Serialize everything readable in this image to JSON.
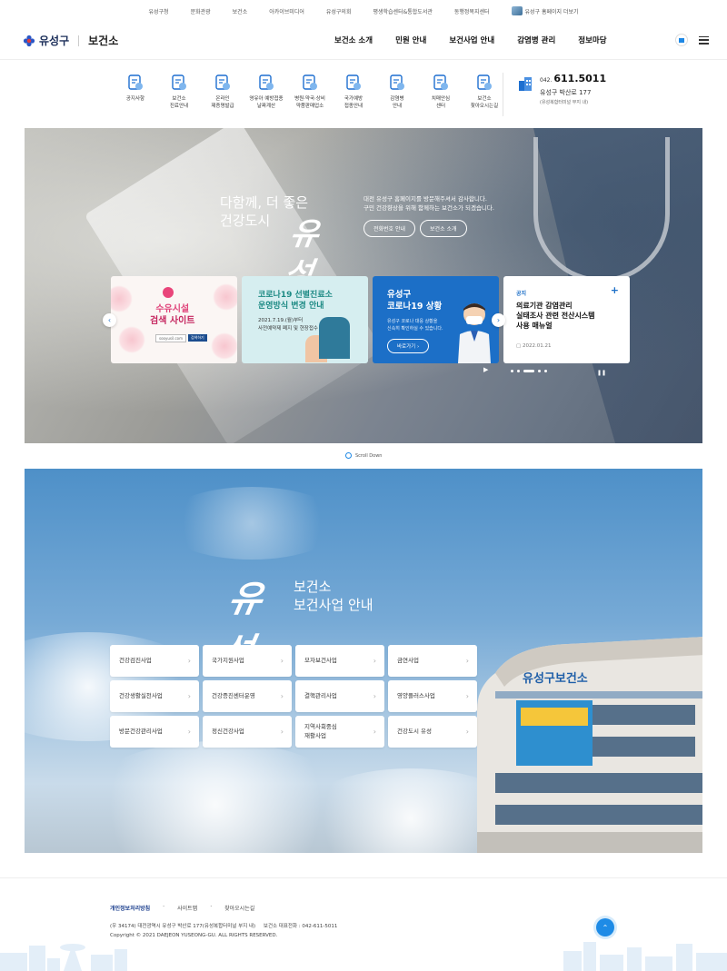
{
  "util": {
    "links": [
      "유성구청",
      "문화관광",
      "보건소",
      "아카이브미디어",
      "유성구의회",
      "평생학습센터&통합도서관",
      "동행정복지센터"
    ],
    "more": "유성구 홈페이지 더보기"
  },
  "header": {
    "logo": "유성구",
    "logo_sub": "보건소",
    "gnb": [
      "보건소 소개",
      "민원 안내",
      "보건사업 안내",
      "감염병 관리",
      "정보마당"
    ]
  },
  "quick": {
    "items": [
      {
        "l1": "공지사항",
        "l2": "",
        "icon": "megaphone-icon"
      },
      {
        "l1": "보건소",
        "l2": "진료안내",
        "icon": "clipboard-icon"
      },
      {
        "l1": "온라인",
        "l2": "제증명발급",
        "icon": "certificate-icon"
      },
      {
        "l1": "영유아 예방접종",
        "l2": "날짜계산",
        "icon": "calendar-icon"
      },
      {
        "l1": "병원·약국·상비",
        "l2": "약품판매업소",
        "icon": "pill-icon"
      },
      {
        "l1": "국가예방",
        "l2": "접종안내",
        "icon": "syringe-icon"
      },
      {
        "l1": "감염병",
        "l2": "안내",
        "icon": "mask-person-icon"
      },
      {
        "l1": "치매안심",
        "l2": "센터",
        "icon": "brain-doc-icon"
      },
      {
        "l1": "보건소",
        "l2": "찾아오시는길",
        "icon": "map-pin-icon"
      }
    ],
    "tel_prefix": "042.",
    "tel": "611.5011",
    "addr": "유성구 박산로 177",
    "addr2": "(유성복합터미널 부지 내)"
  },
  "hero": {
    "title_1": "다함께, 더 좋은",
    "title_2": "건강도시",
    "title_calli": "유성",
    "msg_1": "대전 유성구 홈페이지를 방문해주셔서 감사합니다.",
    "msg_2": "구민 건강향상을 위해 함께하는 보건소가 되겠습니다.",
    "btn_phone": "전화번호 안내",
    "btn_intro": "보건소 소개",
    "card1": {
      "title_1": "수유시설",
      "title_2": "검색 사이트",
      "tag": "sooyusil.com",
      "tag2": "검색하기"
    },
    "card2": {
      "title_1": "코로나19 선별진료소",
      "title_2": "운영방식 변경 안내",
      "s1": "2021.7.19.(월)부터",
      "s2": "사전예약제 폐지 및 현장접수"
    },
    "card3": {
      "title_1": "유성구",
      "title_2": "코로나19 상황",
      "s1": "유성구 코로나 대응 상황을",
      "s2": "신속히 확인하실 수 있습니다.",
      "btn": "바로가기"
    },
    "card4": {
      "label": "공지",
      "title_1": "의료기관 감염관리",
      "title_2": "실태조사 관련 전산시스템",
      "title_3": "사용 매뉴얼",
      "date": "2022.01.21"
    }
  },
  "scroll": "Scroll Down",
  "biz": {
    "calli": "유성",
    "title_1": "보건소",
    "title_2": "보건사업 안내",
    "items": [
      "건강검진사업",
      "국가지원사업",
      "모자보건사업",
      "금연사업",
      "건강생활실천사업",
      "건강증진센터운영",
      "결핵관리사업",
      "영양플러스사업",
      "방문건강관리사업",
      "정신건강사업",
      "지역사회중심\n재활사업",
      "건강도시 유성"
    ]
  },
  "footer": {
    "links": [
      "개인정보처리방침",
      "사이트맵",
      "찾아오시는길"
    ],
    "addr": "(우 34174) 대전광역시 유성구 박산로 177(유성복합터미널 부지 내)     보건소 대표전화 : 042-611-5011",
    "copy": "Copyright © 2021 DAEJEON YUSEONG-GU. ALL RIGHTS RESERVED."
  },
  "colors": {
    "accent": "#1e88e5",
    "navy": "#1c2f5a",
    "pink": "#e0457b",
    "teal": "#1d8a84"
  }
}
